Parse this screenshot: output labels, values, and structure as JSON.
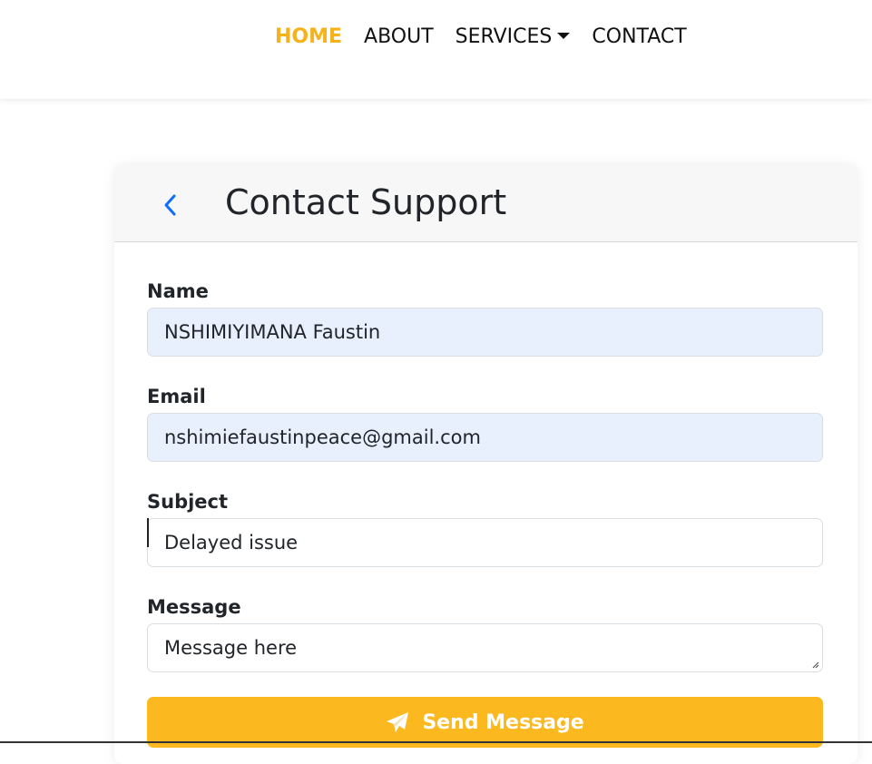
{
  "nav": {
    "items": [
      {
        "label": "HOME",
        "active": true
      },
      {
        "label": "ABOUT",
        "active": false
      },
      {
        "label": "SERVICES",
        "active": false,
        "dropdown": true
      },
      {
        "label": "CONTACT",
        "active": false
      }
    ],
    "active_color": "#f5b21b"
  },
  "card": {
    "title": "Contact Support",
    "back_icon": "chevron-left-icon",
    "back_icon_color": "#0d6efd"
  },
  "form": {
    "name_label": "Name",
    "name_value": "NSHIMIYIMANA Faustin",
    "email_label": "Email",
    "email_value": "nshimiefaustinpeace@gmail.com",
    "subject_label": "Subject",
    "subject_value": "Delayed issue",
    "message_label": "Message",
    "message_placeholder": "Message here",
    "submit_label": "Send Message",
    "submit_icon": "paper-plane-icon",
    "submit_color": "#fbb91f"
  }
}
